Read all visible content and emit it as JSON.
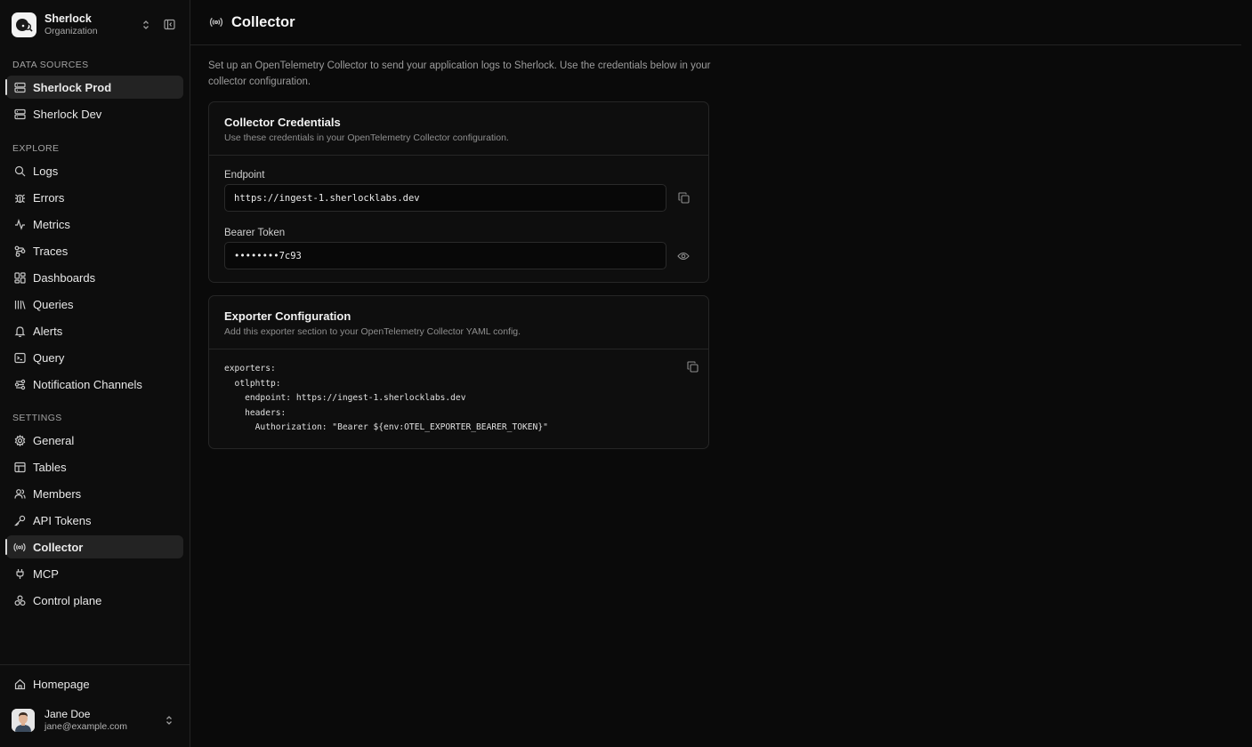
{
  "org": {
    "name": "Sherlock",
    "subtitle": "Organization"
  },
  "sidebar": {
    "data_sources_label": "DATA SOURCES",
    "data_sources": [
      {
        "label": "Sherlock Prod",
        "icon": "database-icon",
        "active": true
      },
      {
        "label": "Sherlock Dev",
        "icon": "database-icon",
        "active": false
      }
    ],
    "explore_label": "EXPLORE",
    "explore": [
      {
        "label": "Logs",
        "icon": "search-icon"
      },
      {
        "label": "Errors",
        "icon": "bug-icon"
      },
      {
        "label": "Metrics",
        "icon": "activity-icon"
      },
      {
        "label": "Traces",
        "icon": "traces-icon"
      },
      {
        "label": "Dashboards",
        "icon": "dashboard-icon"
      },
      {
        "label": "Queries",
        "icon": "library-icon"
      },
      {
        "label": "Alerts",
        "icon": "bell-icon"
      },
      {
        "label": "Query",
        "icon": "terminal-icon"
      },
      {
        "label": "Notification Channels",
        "icon": "channels-icon"
      }
    ],
    "settings_label": "SETTINGS",
    "settings": [
      {
        "label": "General",
        "icon": "gear-icon"
      },
      {
        "label": "Tables",
        "icon": "table-icon"
      },
      {
        "label": "Members",
        "icon": "users-icon"
      },
      {
        "label": "API Tokens",
        "icon": "key-icon"
      },
      {
        "label": "Collector",
        "icon": "radio-icon",
        "active": true
      },
      {
        "label": "MCP",
        "icon": "plug-icon"
      },
      {
        "label": "Control plane",
        "icon": "boxes-icon"
      }
    ],
    "homepage": "Homepage",
    "user": {
      "name": "Jane Doe",
      "email": "jane@example.com"
    }
  },
  "page": {
    "title": "Collector",
    "intro": "Set up an OpenTelemetry Collector to send your application logs to Sherlock. Use the credentials below in your collector configuration.",
    "credentials": {
      "title": "Collector Credentials",
      "description": "Use these credentials in your OpenTelemetry Collector configuration.",
      "endpoint_label": "Endpoint",
      "endpoint_value": "https://ingest-1.sherlocklabs.dev",
      "token_label": "Bearer Token",
      "token_value": "••••••••7c93"
    },
    "exporter": {
      "title": "Exporter Configuration",
      "description": "Add this exporter section to your OpenTelemetry Collector YAML config.",
      "code": "exporters:\n  otlphttp:\n    endpoint: https://ingest-1.sherlocklabs.dev\n    headers:\n      Authorization: \"Bearer ${env:OTEL_EXPORTER_BEARER_TOKEN}\""
    }
  }
}
